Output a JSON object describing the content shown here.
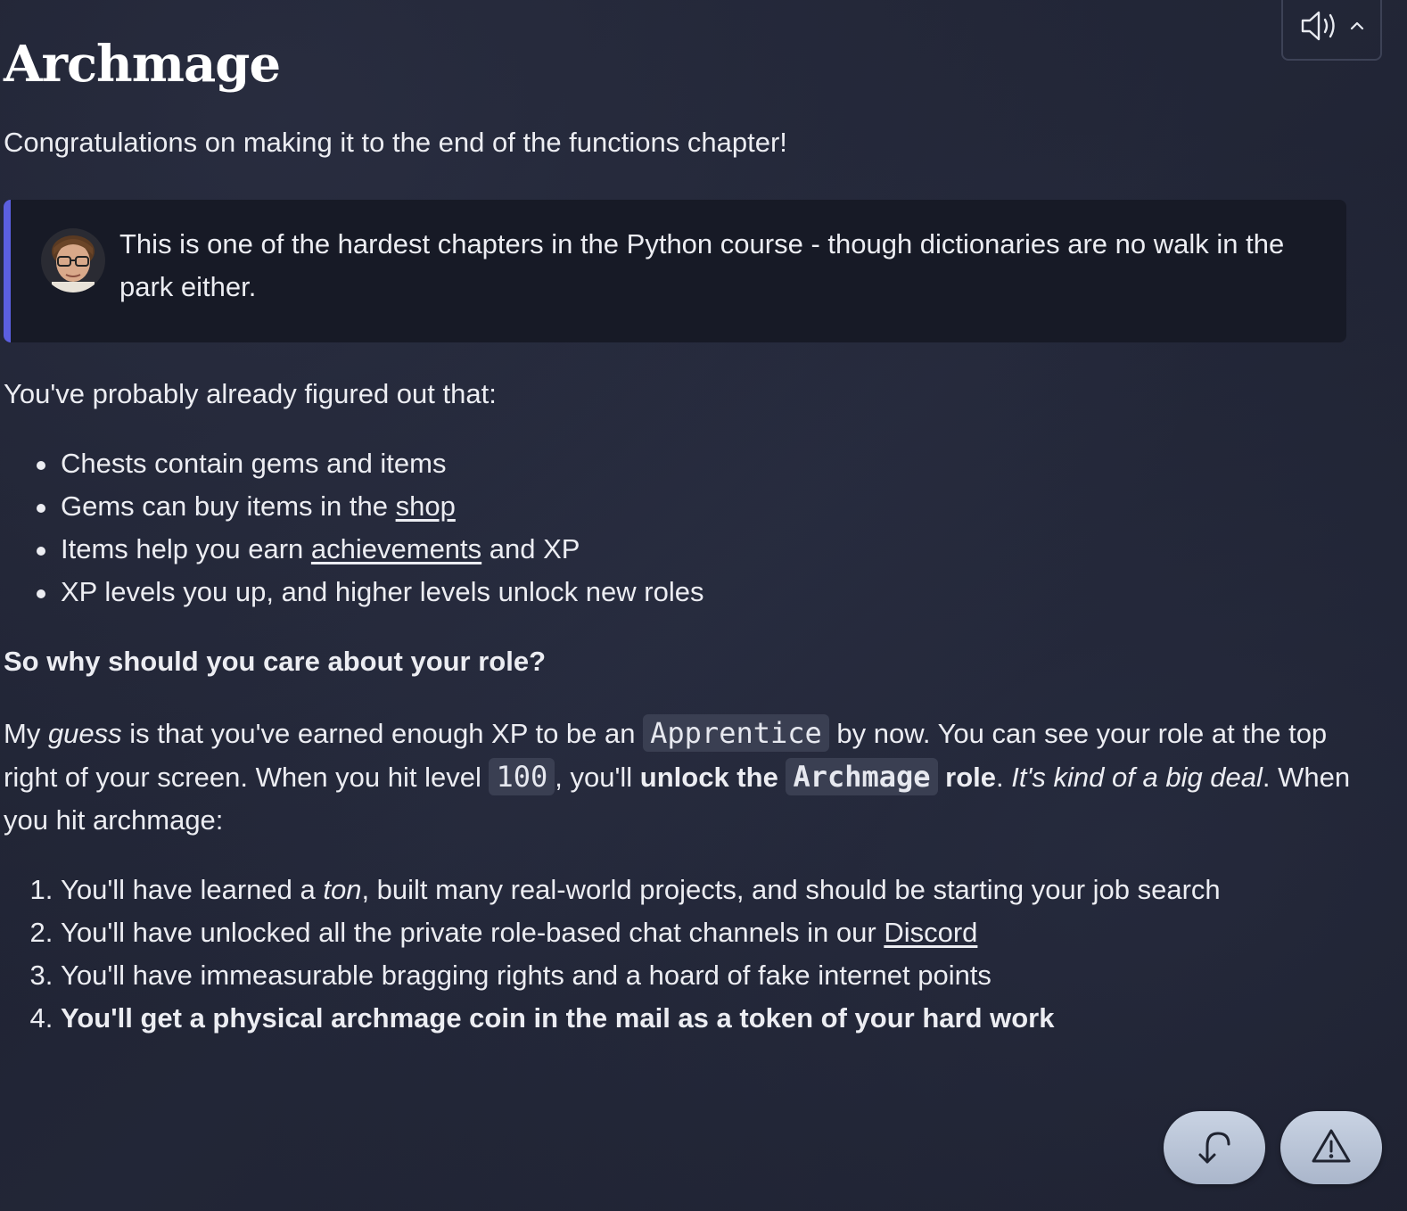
{
  "title": "Archmage",
  "intro": "Congratulations on making it to the end of the functions chapter!",
  "quote": {
    "text": "This is one of the hardest chapters in the Python course - though dictionaries are no walk in the park either."
  },
  "lead": "You've probably already figured out that:",
  "bullets": {
    "b1": "Chests contain gems and items",
    "b2_pre": "Gems can buy items in the ",
    "b2_link": "shop",
    "b3_pre": "Items help you earn ",
    "b3_link": "achievements",
    "b3_post": " and XP",
    "b4": "XP levels you up, and higher levels unlock new roles"
  },
  "subhead": "So why should you care about your role?",
  "para": {
    "s1": "My ",
    "s2_em": "guess",
    "s3": " is that you've earned enough XP to be an ",
    "code1": "Apprentice",
    "s4": " by now. You can see your role at the top right of your screen. When you hit level ",
    "code2": "100",
    "s5": ", you'll ",
    "s6_strong": "unlock the ",
    "code3": "Archmage",
    "s7_strong": " role",
    "s8": ". ",
    "s9_em": "It's kind of a big deal",
    "s10": ". When you hit archmage:"
  },
  "numbered": {
    "n1_pre": "You'll have learned a ",
    "n1_em": "ton",
    "n1_post": ", built many real-world projects, and should be starting your job search",
    "n2_pre": "You'll have unlocked all the private role-based chat channels in our ",
    "n2_link": "Discord",
    "n3": "You'll have immeasurable bragging rights and a hoard of fake internet points",
    "n4": "You'll get a physical archmage coin in the mail as a token of your hard work"
  },
  "icons": {
    "speaker": "speaker-icon",
    "chevron": "chevron-up-icon",
    "undo": "undo-arrow-icon",
    "report": "warning-triangle-icon"
  },
  "colors": {
    "accent": "#5b5fe0",
    "background": "#1b1e2d",
    "fab": "#b8c3d6"
  }
}
